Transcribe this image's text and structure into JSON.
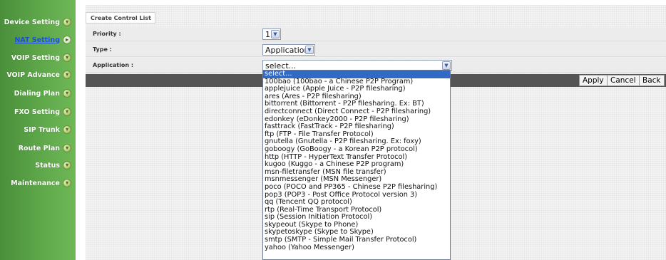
{
  "sidebar": {
    "items": [
      {
        "label": "Device Setting",
        "icon": "arrow-down-circle-icon",
        "active": false
      },
      {
        "label": "NAT Setting",
        "icon": "arrow-right-circle-icon",
        "active": true
      },
      {
        "label": "VOIP Setting",
        "icon": "arrow-down-circle-icon",
        "active": false
      },
      {
        "label": "VOIP Advance",
        "icon": "arrow-down-circle-icon",
        "active": false
      },
      {
        "label": "Dialing Plan",
        "icon": "arrow-down-circle-icon",
        "active": false
      },
      {
        "label": "FXO Setting",
        "icon": "arrow-down-circle-icon",
        "active": false
      },
      {
        "label": "SIP Trunk",
        "icon": "arrow-down-circle-icon",
        "active": false
      },
      {
        "label": "Route Plan",
        "icon": "arrow-down-circle-icon",
        "active": false
      },
      {
        "label": "Status",
        "icon": "arrow-down-circle-icon",
        "active": false
      },
      {
        "label": "Maintenance",
        "icon": "arrow-down-circle-icon",
        "active": false
      }
    ]
  },
  "main": {
    "tab_label": "Create Control List",
    "priority": {
      "label": "Priority :",
      "value": "1"
    },
    "type": {
      "label": "Type :",
      "value": "Application"
    },
    "application": {
      "label": "Application :",
      "value": "select..."
    },
    "buttons": {
      "apply": "Apply",
      "cancel": "Cancel",
      "back": "Back"
    }
  },
  "dropdown": {
    "selected_index": 0,
    "options": [
      "select...",
      "100bao (100bao - a Chinese P2P Program)",
      "applejuice (Apple Juice - P2P filesharing)",
      "ares (Ares - P2P filesharing)",
      "bittorrent (Bittorrent - P2P filesharing. Ex: BT)",
      "directconnect (Direct Connect - P2P filesharing)",
      "edonkey (eDonkey2000 - P2P filesharing)",
      "fasttrack (FastTrack - P2P filesharing)",
      "ftp (FTP - File Transfer Protocol)",
      "gnutella (Gnutella - P2P filesharing. Ex: foxy)",
      "goboogy (GoBoogy - a Korean P2P protocol)",
      "http (HTTP - HyperText Transfer Protocol)",
      "kugoo (Kuggo - a Chinese P2P program)",
      "msn-filetransfer (MSN file transfer)",
      "msnmessenger (MSN Messenger)",
      "poco (POCO and PP365 - Chinese P2P filesharing)",
      "pop3 (POP3 - Post Office Protocol version 3)",
      "qq (Tencent QQ protocol)",
      "rtp (Real-Time Transport Protocol)",
      "sip (Session Initiation Protocol)",
      "skypeout (Skype to Phone)",
      "skypetoskype (Skype to Skype)",
      "smtp (SMTP - Simple Mail Transfer Protocol)",
      "yahoo (Yahoo Messenger)"
    ]
  },
  "colors": {
    "sidebar_green": "#5ea84a",
    "active_link": "#1c4fd6",
    "selection": "#316ac5",
    "action_bar": "#555555"
  }
}
